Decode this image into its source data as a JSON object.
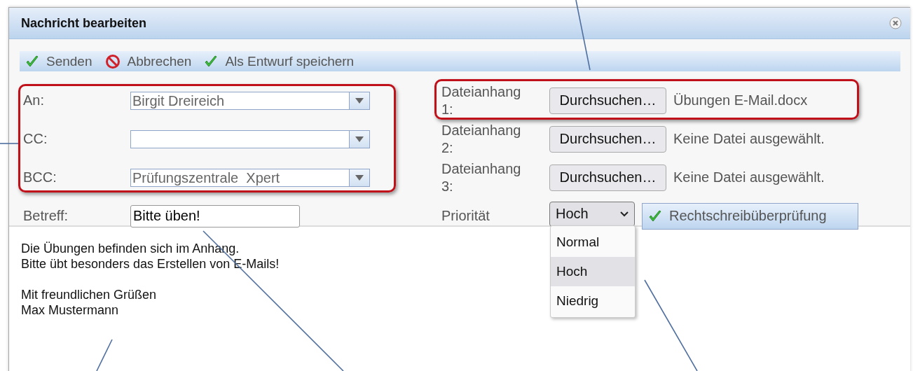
{
  "window": {
    "title": "Nachricht bearbeiten"
  },
  "toolbar": [
    {
      "label": "Senden",
      "kind": "check"
    },
    {
      "label": "Abbrechen",
      "kind": "cancel"
    },
    {
      "label": "Als Entwurf speichern",
      "kind": "check"
    }
  ],
  "recipients": [
    {
      "label": "An:",
      "value": "Birgit Dreireich"
    },
    {
      "label": "CC:"
    },
    {
      "label": "BCC:",
      "value": "Prüfungszentrale  Xpert"
    }
  ],
  "subject": {
    "label": "Betreff:",
    "value": "Bitte üben!"
  },
  "attachments": [
    {
      "label": "Dateianhang 1:",
      "button": "Durchsuchen…",
      "file": "Übungen E-Mail.docx"
    },
    {
      "label": "Dateianhang 2:",
      "button": "Durchsuchen…",
      "file": "Keine Datei ausgewählt."
    },
    {
      "label": "Dateianhang 3:",
      "button": "Durchsuchen…",
      "file": "Keine Datei ausgewählt."
    }
  ],
  "priority": {
    "label": "Priorität",
    "value": "Hoch",
    "options": [
      {
        "label": "Normal",
        "selected": false
      },
      {
        "label": "Hoch",
        "selected": true
      },
      {
        "label": "Niedrig",
        "selected": false
      }
    ]
  },
  "spellcheck_button": "Rechtschreibüberprüfung",
  "body": [
    [
      "Die Übungen befinden sich im Anhang.",
      "Bitte übt besonders das Erstellen von E-Mails!"
    ],
    [
      "Mit freundlichen Grüßen",
      "Max Mustermann"
    ]
  ]
}
